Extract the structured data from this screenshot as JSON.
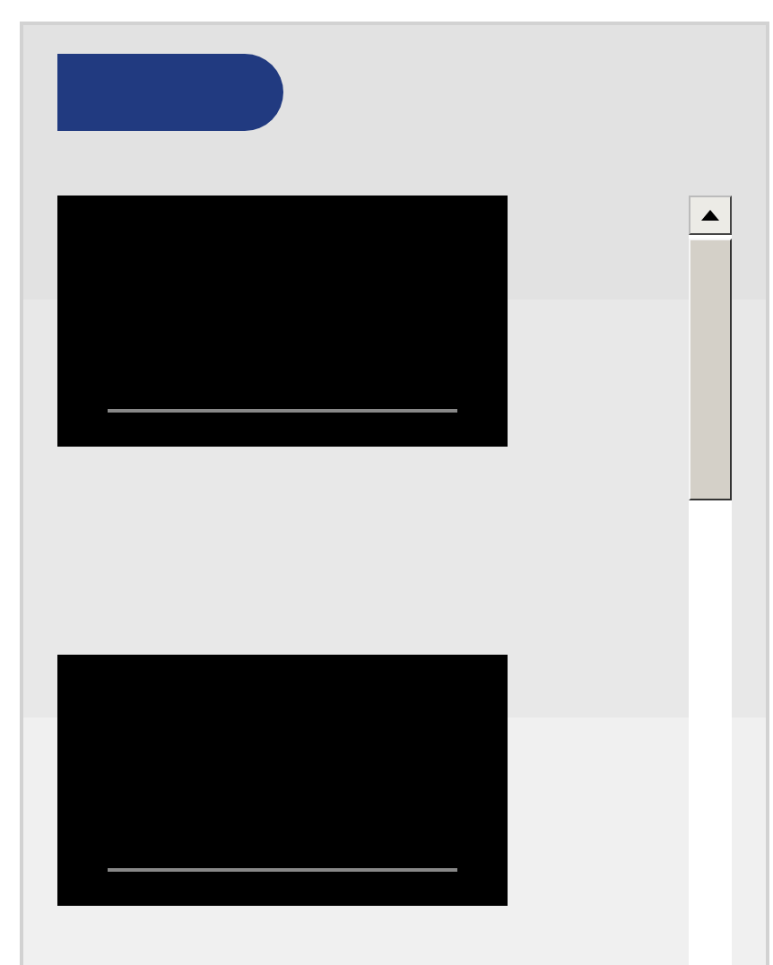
{
  "header_button": {
    "kind": "pill"
  },
  "videos": [
    {
      "kind": "video"
    },
    {
      "kind": "video"
    }
  ]
}
